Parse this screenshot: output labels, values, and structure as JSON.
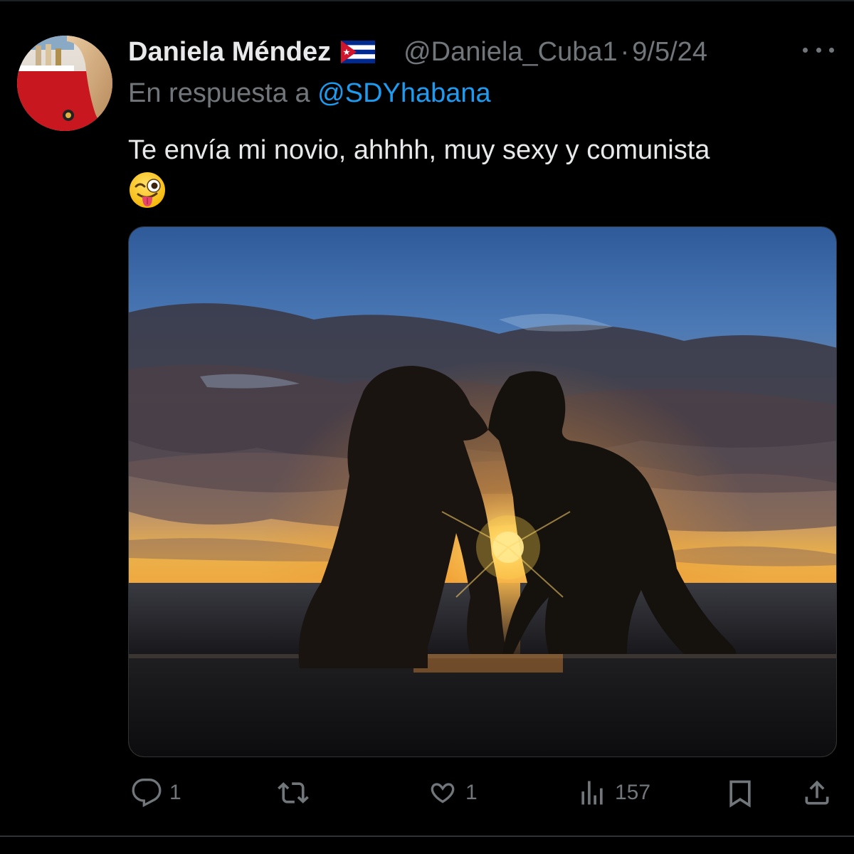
{
  "author": {
    "display_name": "Daniela Méndez",
    "handle": "@Daniela_Cuba1",
    "separator": "·",
    "date": "9/5/24",
    "flag_icon": "cuba-flag-icon"
  },
  "reply": {
    "prefix": "En respuesta a ",
    "mention": "@SDYhabana"
  },
  "tweet": {
    "text": "Te envía mi novio, ahhhh, muy sexy y comunista",
    "emoji_icon": "winking-face-with-tongue-icon"
  },
  "media": {
    "type": "photo"
  },
  "actions": {
    "replies": "1",
    "reposts": "",
    "likes": "1",
    "views": "157"
  },
  "colors": {
    "background": "#000000",
    "text": "#e7e9ea",
    "muted": "#71767b",
    "link": "#1d9bf0"
  }
}
